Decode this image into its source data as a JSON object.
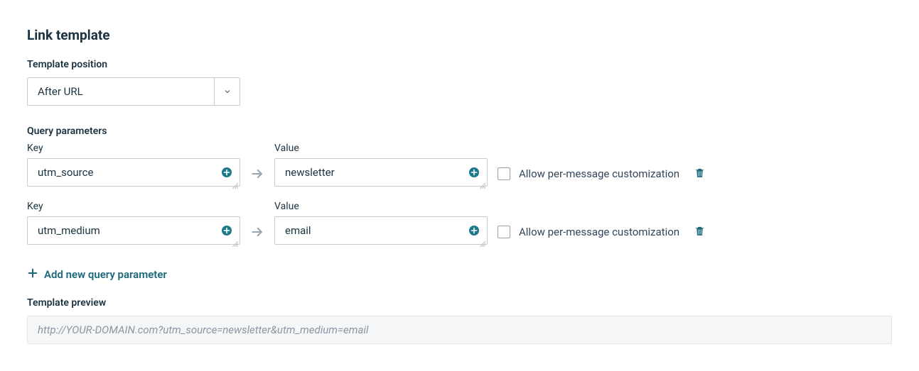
{
  "title": "Link template",
  "template_position": {
    "label": "Template position",
    "value": "After URL"
  },
  "query_parameters_label": "Query parameters",
  "key_label": "Key",
  "value_label": "Value",
  "allow_customization_label": "Allow per-message customization",
  "rows": [
    {
      "key": "utm_source",
      "value": "newsletter"
    },
    {
      "key": "utm_medium",
      "value": "email"
    }
  ],
  "add_new_label": "Add new query parameter",
  "preview_label": "Template preview",
  "preview_text": "http://YOUR-DOMAIN.com?utm_source=newsletter&utm_medium=email"
}
